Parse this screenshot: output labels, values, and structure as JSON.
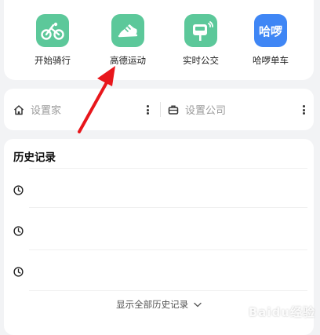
{
  "quick_actions": [
    {
      "label": "开始骑行",
      "icon": "bicycle-icon",
      "color": "#5cc89a"
    },
    {
      "label": "高德运动",
      "icon": "running-shoe-icon",
      "color": "#5cc89a"
    },
    {
      "label": "实时公交",
      "icon": "bus-stop-icon",
      "color": "#5cc89a"
    },
    {
      "label": "哈啰单车",
      "icon": "hello-logo-icon",
      "icon_text": "哈啰",
      "color": "#3f86f5"
    }
  ],
  "addresses": {
    "home": {
      "label": "设置家",
      "icon": "home-icon"
    },
    "company": {
      "label": "设置公司",
      "icon": "briefcase-icon"
    }
  },
  "history": {
    "title": "历史记录",
    "items": [
      {
        "icon": "clock-icon"
      },
      {
        "icon": "clock-icon"
      },
      {
        "icon": "clock-icon"
      }
    ],
    "show_all_label": "显示全部历史记录"
  },
  "watermark_text": "Baidu经验"
}
